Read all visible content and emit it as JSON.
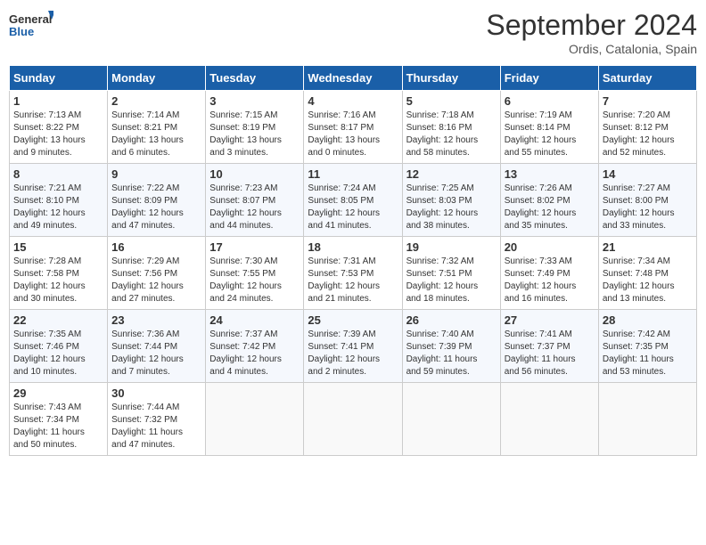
{
  "header": {
    "logo_line1": "General",
    "logo_line2": "Blue",
    "month_title": "September 2024",
    "subtitle": "Ordis, Catalonia, Spain"
  },
  "days_of_week": [
    "Sunday",
    "Monday",
    "Tuesday",
    "Wednesday",
    "Thursday",
    "Friday",
    "Saturday"
  ],
  "weeks": [
    [
      {
        "day": "1",
        "info": "Sunrise: 7:13 AM\nSunset: 8:22 PM\nDaylight: 13 hours\nand 9 minutes."
      },
      {
        "day": "2",
        "info": "Sunrise: 7:14 AM\nSunset: 8:21 PM\nDaylight: 13 hours\nand 6 minutes."
      },
      {
        "day": "3",
        "info": "Sunrise: 7:15 AM\nSunset: 8:19 PM\nDaylight: 13 hours\nand 3 minutes."
      },
      {
        "day": "4",
        "info": "Sunrise: 7:16 AM\nSunset: 8:17 PM\nDaylight: 13 hours\nand 0 minutes."
      },
      {
        "day": "5",
        "info": "Sunrise: 7:18 AM\nSunset: 8:16 PM\nDaylight: 12 hours\nand 58 minutes."
      },
      {
        "day": "6",
        "info": "Sunrise: 7:19 AM\nSunset: 8:14 PM\nDaylight: 12 hours\nand 55 minutes."
      },
      {
        "day": "7",
        "info": "Sunrise: 7:20 AM\nSunset: 8:12 PM\nDaylight: 12 hours\nand 52 minutes."
      }
    ],
    [
      {
        "day": "8",
        "info": "Sunrise: 7:21 AM\nSunset: 8:10 PM\nDaylight: 12 hours\nand 49 minutes."
      },
      {
        "day": "9",
        "info": "Sunrise: 7:22 AM\nSunset: 8:09 PM\nDaylight: 12 hours\nand 47 minutes."
      },
      {
        "day": "10",
        "info": "Sunrise: 7:23 AM\nSunset: 8:07 PM\nDaylight: 12 hours\nand 44 minutes."
      },
      {
        "day": "11",
        "info": "Sunrise: 7:24 AM\nSunset: 8:05 PM\nDaylight: 12 hours\nand 41 minutes."
      },
      {
        "day": "12",
        "info": "Sunrise: 7:25 AM\nSunset: 8:03 PM\nDaylight: 12 hours\nand 38 minutes."
      },
      {
        "day": "13",
        "info": "Sunrise: 7:26 AM\nSunset: 8:02 PM\nDaylight: 12 hours\nand 35 minutes."
      },
      {
        "day": "14",
        "info": "Sunrise: 7:27 AM\nSunset: 8:00 PM\nDaylight: 12 hours\nand 33 minutes."
      }
    ],
    [
      {
        "day": "15",
        "info": "Sunrise: 7:28 AM\nSunset: 7:58 PM\nDaylight: 12 hours\nand 30 minutes."
      },
      {
        "day": "16",
        "info": "Sunrise: 7:29 AM\nSunset: 7:56 PM\nDaylight: 12 hours\nand 27 minutes."
      },
      {
        "day": "17",
        "info": "Sunrise: 7:30 AM\nSunset: 7:55 PM\nDaylight: 12 hours\nand 24 minutes."
      },
      {
        "day": "18",
        "info": "Sunrise: 7:31 AM\nSunset: 7:53 PM\nDaylight: 12 hours\nand 21 minutes."
      },
      {
        "day": "19",
        "info": "Sunrise: 7:32 AM\nSunset: 7:51 PM\nDaylight: 12 hours\nand 18 minutes."
      },
      {
        "day": "20",
        "info": "Sunrise: 7:33 AM\nSunset: 7:49 PM\nDaylight: 12 hours\nand 16 minutes."
      },
      {
        "day": "21",
        "info": "Sunrise: 7:34 AM\nSunset: 7:48 PM\nDaylight: 12 hours\nand 13 minutes."
      }
    ],
    [
      {
        "day": "22",
        "info": "Sunrise: 7:35 AM\nSunset: 7:46 PM\nDaylight: 12 hours\nand 10 minutes."
      },
      {
        "day": "23",
        "info": "Sunrise: 7:36 AM\nSunset: 7:44 PM\nDaylight: 12 hours\nand 7 minutes."
      },
      {
        "day": "24",
        "info": "Sunrise: 7:37 AM\nSunset: 7:42 PM\nDaylight: 12 hours\nand 4 minutes."
      },
      {
        "day": "25",
        "info": "Sunrise: 7:39 AM\nSunset: 7:41 PM\nDaylight: 12 hours\nand 2 minutes."
      },
      {
        "day": "26",
        "info": "Sunrise: 7:40 AM\nSunset: 7:39 PM\nDaylight: 11 hours\nand 59 minutes."
      },
      {
        "day": "27",
        "info": "Sunrise: 7:41 AM\nSunset: 7:37 PM\nDaylight: 11 hours\nand 56 minutes."
      },
      {
        "day": "28",
        "info": "Sunrise: 7:42 AM\nSunset: 7:35 PM\nDaylight: 11 hours\nand 53 minutes."
      }
    ],
    [
      {
        "day": "29",
        "info": "Sunrise: 7:43 AM\nSunset: 7:34 PM\nDaylight: 11 hours\nand 50 minutes."
      },
      {
        "day": "30",
        "info": "Sunrise: 7:44 AM\nSunset: 7:32 PM\nDaylight: 11 hours\nand 47 minutes."
      },
      {
        "day": "",
        "info": ""
      },
      {
        "day": "",
        "info": ""
      },
      {
        "day": "",
        "info": ""
      },
      {
        "day": "",
        "info": ""
      },
      {
        "day": "",
        "info": ""
      }
    ]
  ]
}
